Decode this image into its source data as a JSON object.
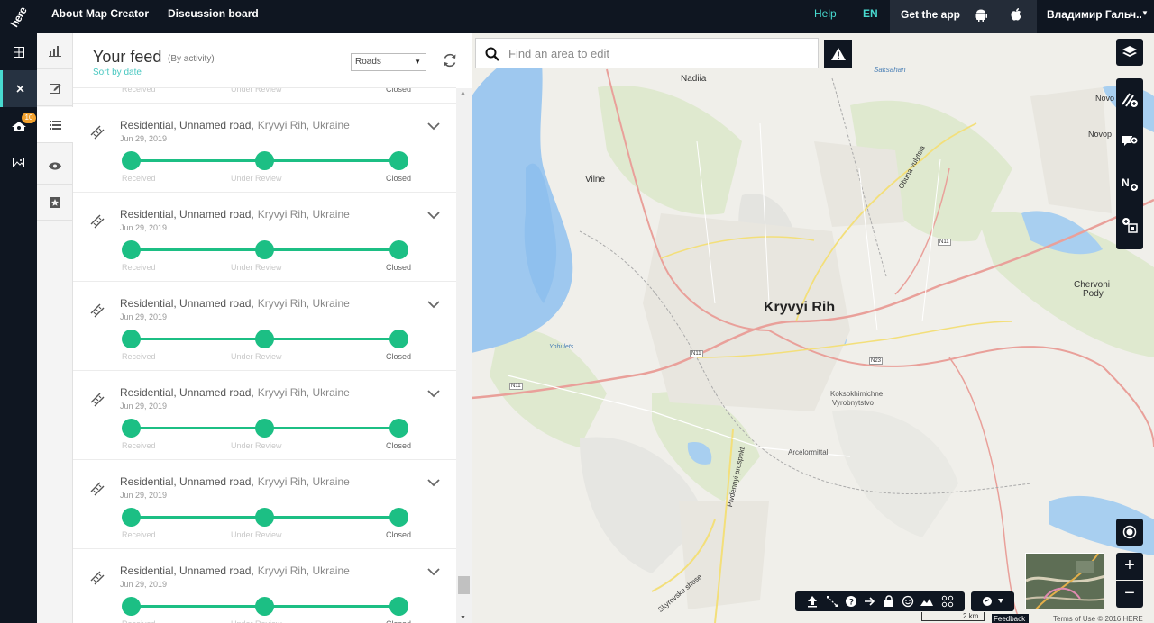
{
  "brand": {
    "logo_text": "here",
    "accent": "#48dad0",
    "dark": "#0f1621",
    "status_green": "#1cbf84"
  },
  "topbar": {
    "links": [
      "About Map Creator",
      "Discussion board"
    ],
    "help": "Help",
    "language": "EN",
    "get_app": "Get the app",
    "user": "Владимир Гальч..."
  },
  "rail": {
    "badge": "10",
    "icons": [
      "grid-icon",
      "close-icon",
      "community-icon",
      "photo-icon"
    ]
  },
  "rail2": {
    "icons": [
      "stats-icon",
      "edit-icon",
      "list-icon",
      "eye-icon",
      "star-icon"
    ]
  },
  "feed": {
    "title": "Your feed",
    "subtitle": "(By activity)",
    "sort_link": "Sort by date",
    "filter": "Roads",
    "steps": [
      "Received",
      "Under Review",
      "Closed"
    ],
    "items": [
      {
        "title": "Residential, Unnamed road,",
        "location": "Kryvyi Rih, Ukraine",
        "date": "Jun 29, 2019"
      },
      {
        "title": "Residential, Unnamed road,",
        "location": "Kryvyi Rih, Ukraine",
        "date": "Jun 29, 2019"
      },
      {
        "title": "Residential, Unnamed road,",
        "location": "Kryvyi Rih, Ukraine",
        "date": "Jun 29, 2019"
      },
      {
        "title": "Residential, Unnamed road,",
        "location": "Kryvyi Rih, Ukraine",
        "date": "Jun 29, 2019"
      },
      {
        "title": "Residential, Unnamed road,",
        "location": "Kryvyi Rih, Ukraine",
        "date": "Jun 29, 2019"
      },
      {
        "title": "Residential, Unnamed road,",
        "location": "Kryvyi Rih, Ukraine",
        "date": "Jun 29, 2019"
      }
    ]
  },
  "map": {
    "search_placeholder": "Find an area to edit",
    "labels": {
      "city": "Kryvyi Rih",
      "nadiia": "Nadiia",
      "vilne": "Vilne",
      "saksahan": "Saksahan",
      "chervoni": "Chervoni",
      "pody": "Pody",
      "koksokhimichne": "Koksokhimichne",
      "vyrobnytstvo": "Vyrobnytstvo",
      "arcelormittal": "Arcelormittal",
      "ynhulets": "Ynhulets",
      "obuna": "Obuna vulytsia",
      "pivdennyi": "Pivdennyi prospekt",
      "shose": "Skyrovske shose",
      "n11a": "N11",
      "n11b": "N11",
      "n11c": "N11",
      "n23": "N23",
      "novo": "Novo",
      "novop": "Novop"
    },
    "scale": "2 km",
    "feedback": "Feedback",
    "terms": "Terms of Use © 2016 HERE"
  }
}
